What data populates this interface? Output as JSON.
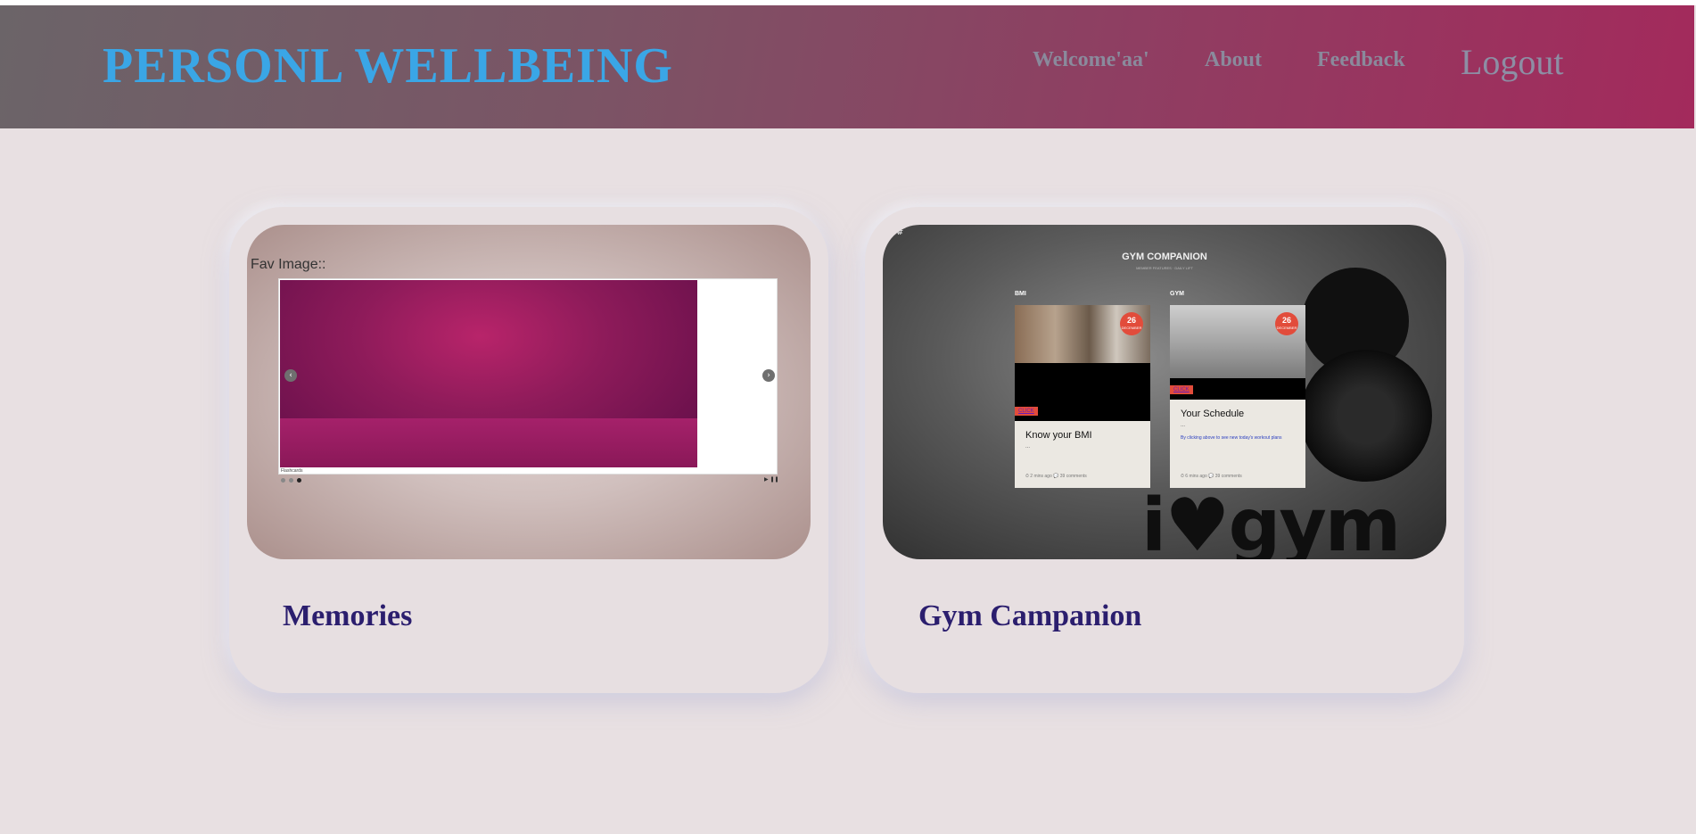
{
  "header": {
    "brand": "PERSONL WELLBEING",
    "nav": {
      "welcome": "Welcome'aa'",
      "about": "About",
      "feedback": "Feedback",
      "logout": "Logout"
    }
  },
  "cards": {
    "memories": {
      "title": "Memories",
      "fav_label": "Fav Image::",
      "caption": "Flashcards",
      "prev_icon": "chevron-left-icon",
      "next_icon": "chevron-right-icon",
      "prev_glyph": "‹",
      "next_glyph": "›",
      "play_pause": "▶ ❚❚"
    },
    "gym": {
      "title": "Gym Campanion",
      "hash": "##",
      "preview_title": "GYM COMPANION",
      "preview_subtitle": "MEMBER FEATURES · DAILY LIFT",
      "bmi_tag": "BMI",
      "gym_tag": "GYM",
      "badge_num": "26",
      "badge_month": "DECEMBER",
      "click_label": "CLICK",
      "bmi_card_title": "Know your BMI",
      "bmi_dash": "...",
      "bmi_meta": "⏱ 2 mins ago   💬 39 comments",
      "schedule_title": "Your Schedule",
      "schedule_dash": "...",
      "schedule_text": "By clicking above to see new today's workout plans",
      "schedule_meta": "⏱ 6 mins ago   💬 39 comments",
      "watermark": "i♥gym"
    }
  },
  "colors": {
    "brand": "#3aa6e6",
    "card_title": "#2b1e6e",
    "header_start": "#6b6468",
    "header_end": "#a32a5c"
  }
}
